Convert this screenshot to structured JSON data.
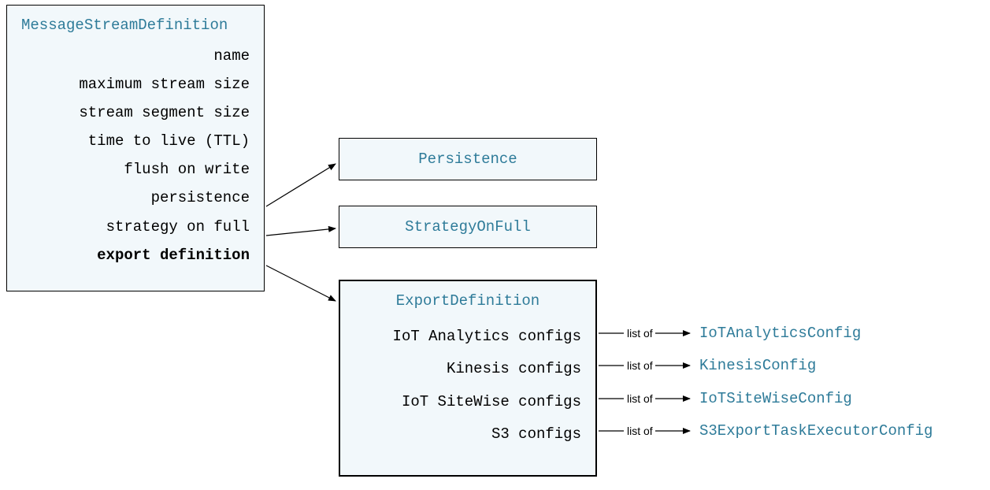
{
  "msd": {
    "title": "MessageStreamDefinition",
    "props": [
      "name",
      "maximum stream size",
      "stream segment size",
      "time to live (TTL)",
      "flush on write",
      "persistence",
      "strategy on full",
      "export definition"
    ]
  },
  "persistence": {
    "title": "Persistence"
  },
  "strategyOnFull": {
    "title": "StrategyOnFull"
  },
  "exportDefinition": {
    "title": "ExportDefinition",
    "props": [
      "IoT Analytics configs",
      "Kinesis configs",
      "IoT SiteWise configs",
      "S3 configs"
    ]
  },
  "listOfLabel": "list of",
  "types": {
    "iotAnalytics": "IoTAnalyticsConfig",
    "kinesis": "KinesisConfig",
    "iotSiteWise": "IoTSiteWiseConfig",
    "s3": "S3ExportTaskExecutorConfig"
  }
}
